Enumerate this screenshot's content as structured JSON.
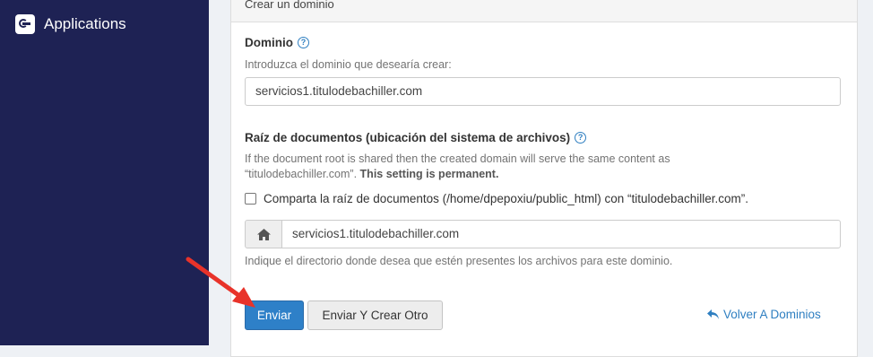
{
  "sidebar": {
    "app_label": "Applications"
  },
  "panel": {
    "heading": "Crear un dominio"
  },
  "domain": {
    "label": "Dominio",
    "hint": "Introduzca el dominio que desearía crear:",
    "value": "servicios1.titulodebachiller.com"
  },
  "docroot": {
    "label": "Raíz de documentos (ubicación del sistema de archivos)",
    "hint_line1": "If the document root is shared then the created domain will serve the same content as",
    "hint_line2": "“titulodebachiller.com”.",
    "hint_bold": "This setting is permanent.",
    "checkbox_label": "Comparta la raíz de documentos (/home/dpepoxiu/public_html) con “titulodebachiller.com”.",
    "checkbox_checked": false,
    "value": "servicios1.titulodebachiller.com",
    "hint_after": "Indique el directorio donde desea que estén presentes los archivos para este dominio."
  },
  "buttons": {
    "submit": "Enviar",
    "submit_another": "Enviar Y Crear Otro",
    "back": "Volver A Dominios"
  },
  "colors": {
    "sidebar": "#1e2254",
    "primary": "#2e80c8",
    "link": "#2f7fc1",
    "annotation_arrow": "#e8332a"
  }
}
